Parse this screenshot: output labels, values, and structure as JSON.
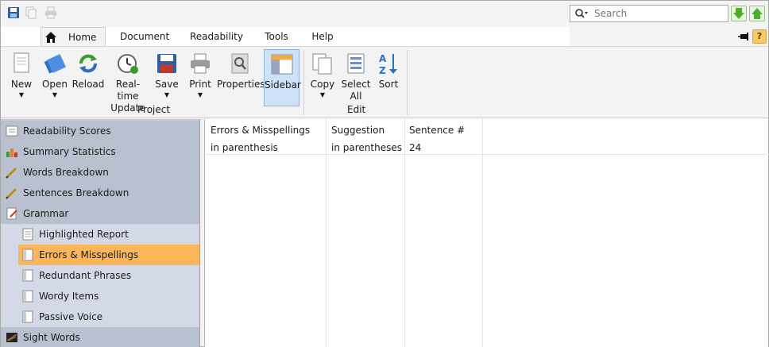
{
  "title_bar": {
    "search_placeholder": "Search"
  },
  "tabs": [
    {
      "label": "Home"
    },
    {
      "label": "Document"
    },
    {
      "label": "Readability"
    },
    {
      "label": "Tools"
    },
    {
      "label": "Help"
    }
  ],
  "help_label": "?",
  "ribbon": {
    "new": "New",
    "open": "Open",
    "reload": "Reload",
    "realtime": "Real-time\nUpdate",
    "save": "Save",
    "print": "Print",
    "properties": "Properties",
    "sidebar": "Sidebar",
    "copy": "Copy",
    "select_all": "Select\nAll",
    "sort": "Sort",
    "group_project": "Project",
    "group_edit": "Edit"
  },
  "sidebar": {
    "items": [
      {
        "label": "Readability Scores",
        "icon": "scores-icon"
      },
      {
        "label": "Summary Statistics",
        "icon": "statistics-icon"
      },
      {
        "label": "Words Breakdown",
        "icon": "pencil-icon"
      },
      {
        "label": "Sentences Breakdown",
        "icon": "pencil-icon"
      },
      {
        "label": "Grammar",
        "icon": "grammar-icon"
      },
      {
        "label": "Highlighted Report",
        "icon": "report-icon"
      },
      {
        "label": "Errors & Misspellings",
        "icon": "list-icon"
      },
      {
        "label": "Redundant Phrases",
        "icon": "list-icon"
      },
      {
        "label": "Wordy Items",
        "icon": "list-icon"
      },
      {
        "label": "Passive Voice",
        "icon": "list-icon"
      },
      {
        "label": "Sight Words",
        "icon": "sight-words-icon"
      }
    ]
  },
  "table": {
    "headers": [
      "Errors & Misspellings",
      "Suggestion",
      "Sentence #"
    ],
    "rows": [
      [
        "in parenthesis",
        "in parentheses",
        "24"
      ]
    ]
  },
  "colors": {
    "selected": "#fbb65a",
    "sidebar_bg": "#c5cbd8",
    "pressed": "#cde2f7"
  }
}
